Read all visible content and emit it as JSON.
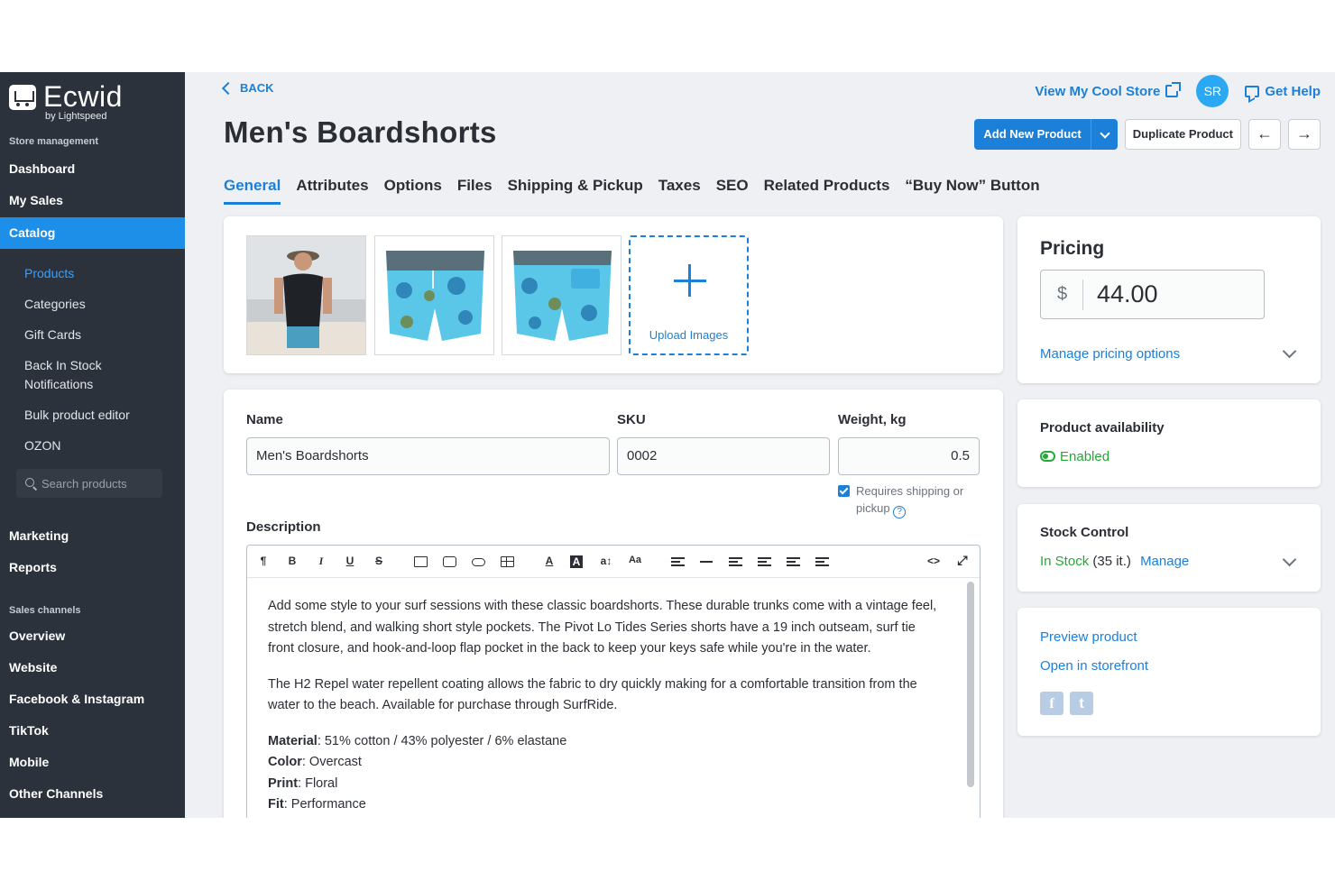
{
  "sidebar": {
    "logo_name": "Ecwid",
    "logo_sub": "by Lightspeed",
    "section_store": "Store management",
    "dashboard": "Dashboard",
    "my_sales": "My Sales",
    "catalog": "Catalog",
    "catalog_items": [
      "Products",
      "Categories",
      "Gift Cards",
      "Back In Stock Notifications",
      "Bulk product editor",
      "OZON"
    ],
    "search_placeholder": "Search products",
    "marketing": "Marketing",
    "reports": "Reports",
    "section_channels": "Sales channels",
    "channels": [
      "Overview",
      "Website",
      "Facebook & Instagram",
      "TikTok",
      "Mobile",
      "Other Channels"
    ]
  },
  "header": {
    "back": "BACK",
    "title": "Men's Boardshorts",
    "view_store": "View My Cool Store",
    "avatar": "SR",
    "get_help": "Get Help",
    "add_new": "Add New Product",
    "duplicate": "Duplicate Product",
    "prev": "←",
    "next": "→"
  },
  "tabs": [
    "General",
    "Attributes",
    "Options",
    "Files",
    "Shipping & Pickup",
    "Taxes",
    "SEO",
    "Related Products",
    "“Buy Now” Button"
  ],
  "images": {
    "upload_label": "Upload Images"
  },
  "form": {
    "name_label": "Name",
    "name_value": "Men's Boardshorts",
    "sku_label": "SKU",
    "sku_value": "0002",
    "weight_label": "Weight, kg",
    "weight_value": "0.5",
    "requires_shipping": "Requires shipping or pickup",
    "help_glyph": "?",
    "description_label": "Description",
    "toolbar": {
      "paragraph": "¶",
      "bold": "B",
      "italic": "I",
      "underline": "U",
      "strike": "S",
      "font_color": "A",
      "bg_color": "A",
      "font_size": "a↕",
      "case": "Aa",
      "code": "<>",
      "fullscreen": "⤢"
    },
    "description": {
      "p1": "Add some style to your surf sessions with these classic boardshorts. These durable trunks come with a vintage feel, stretch blend, and walking short style pockets. The Pivot Lo Tides Series shorts have a 19 inch outseam, surf tie front closure, and hook-and-loop flap pocket in the back to keep your keys safe while you're in the water.",
      "p2": "The H2 Repel water repellent coating allows the fabric to dry quickly making for a comfortable transition from the water to the beach. Available for purchase through SurfRide.",
      "specs": [
        {
          "key": "Material",
          "value": ": 51% cotton / 43% polyester / 6% elastane"
        },
        {
          "key": "Color",
          "value": ": Overcast"
        },
        {
          "key": "Print",
          "value": ": Floral"
        },
        {
          "key": "Fit",
          "value": ": Performance"
        }
      ]
    }
  },
  "pricing": {
    "title": "Pricing",
    "currency": "$",
    "price": "44.00",
    "manage": "Manage pricing options"
  },
  "availability": {
    "title": "Product availability",
    "status": "Enabled"
  },
  "stock": {
    "title": "Stock Control",
    "status": "In Stock",
    "count": "(35 it.)",
    "manage": "Manage"
  },
  "preview": {
    "preview": "Preview product",
    "open": "Open in storefront",
    "facebook": "f",
    "twitter": "t"
  },
  "colors": {
    "accent": "#1c7fd8",
    "sidebar": "#2c323b",
    "active_nav": "#1d8fe8",
    "success": "#25a837"
  }
}
